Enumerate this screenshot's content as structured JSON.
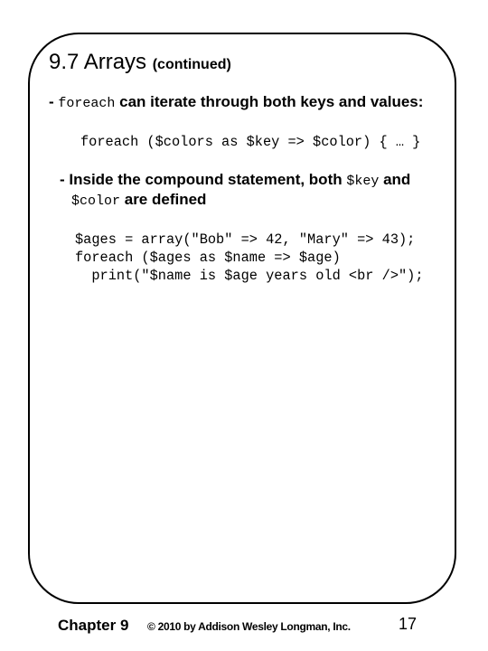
{
  "slide": {
    "title": "9.7 Arrays",
    "subtitle": "(continued)",
    "bullets": [
      {
        "prefix": "- ",
        "code_term": "foreach",
        "text": " can iterate through both keys and values:"
      },
      {
        "line1_prefix": "- Inside the compound statement, both ",
        "line1_code": "$key",
        "line1_suffix": " and",
        "line2_code": "$color",
        "line2_suffix": " are defined"
      }
    ],
    "code_example_1": "foreach ($colors as $key => $color) { … }",
    "code_example_2": [
      "$ages = array(\"Bob\" => 42, \"Mary\" => 43);",
      "foreach ($ages as $name => $age)",
      "  print(\"$name is $age years old <br />\");"
    ]
  },
  "footer": {
    "chapter": "Chapter 9",
    "copyright": "© 2010 by Addison Wesley Longman, Inc.",
    "page_number": "17"
  }
}
